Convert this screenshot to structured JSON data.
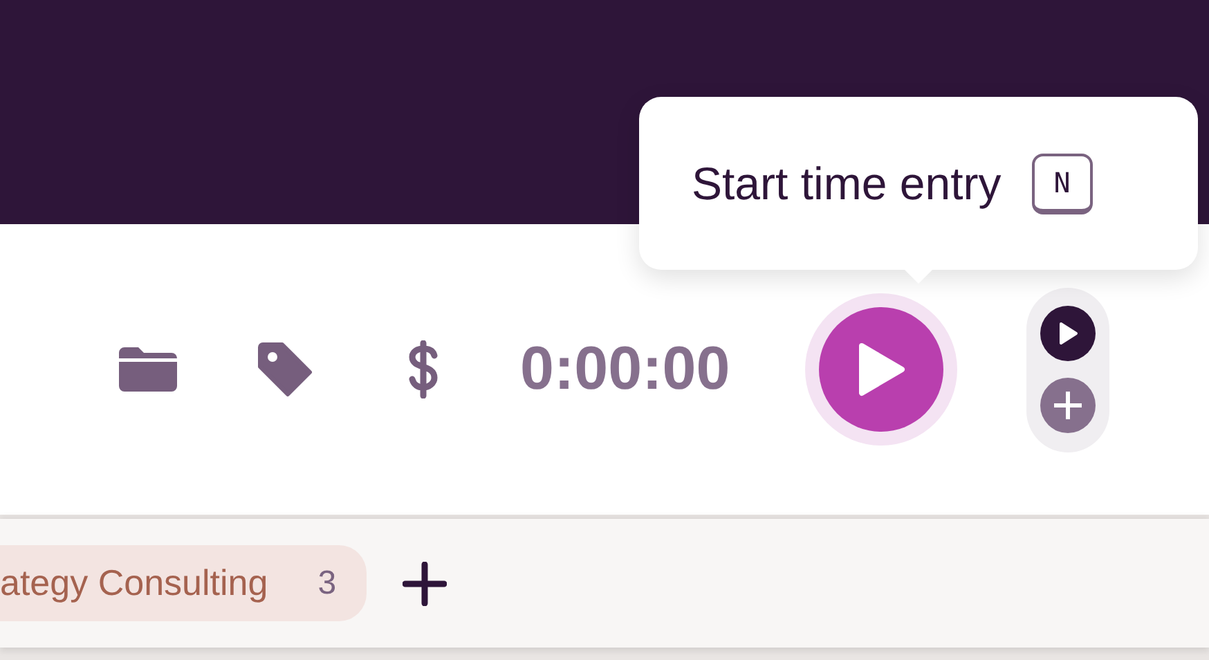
{
  "tooltip": {
    "text": "Start time entry",
    "shortcut": "N"
  },
  "timer": {
    "elapsed": "0:00:00",
    "billable": false
  },
  "modes": [
    {
      "kind": "timer",
      "selected": true
    },
    {
      "kind": "manual",
      "selected": false
    }
  ],
  "project_chips": [
    {
      "label": "ategy Consulting",
      "count": "3"
    }
  ]
}
